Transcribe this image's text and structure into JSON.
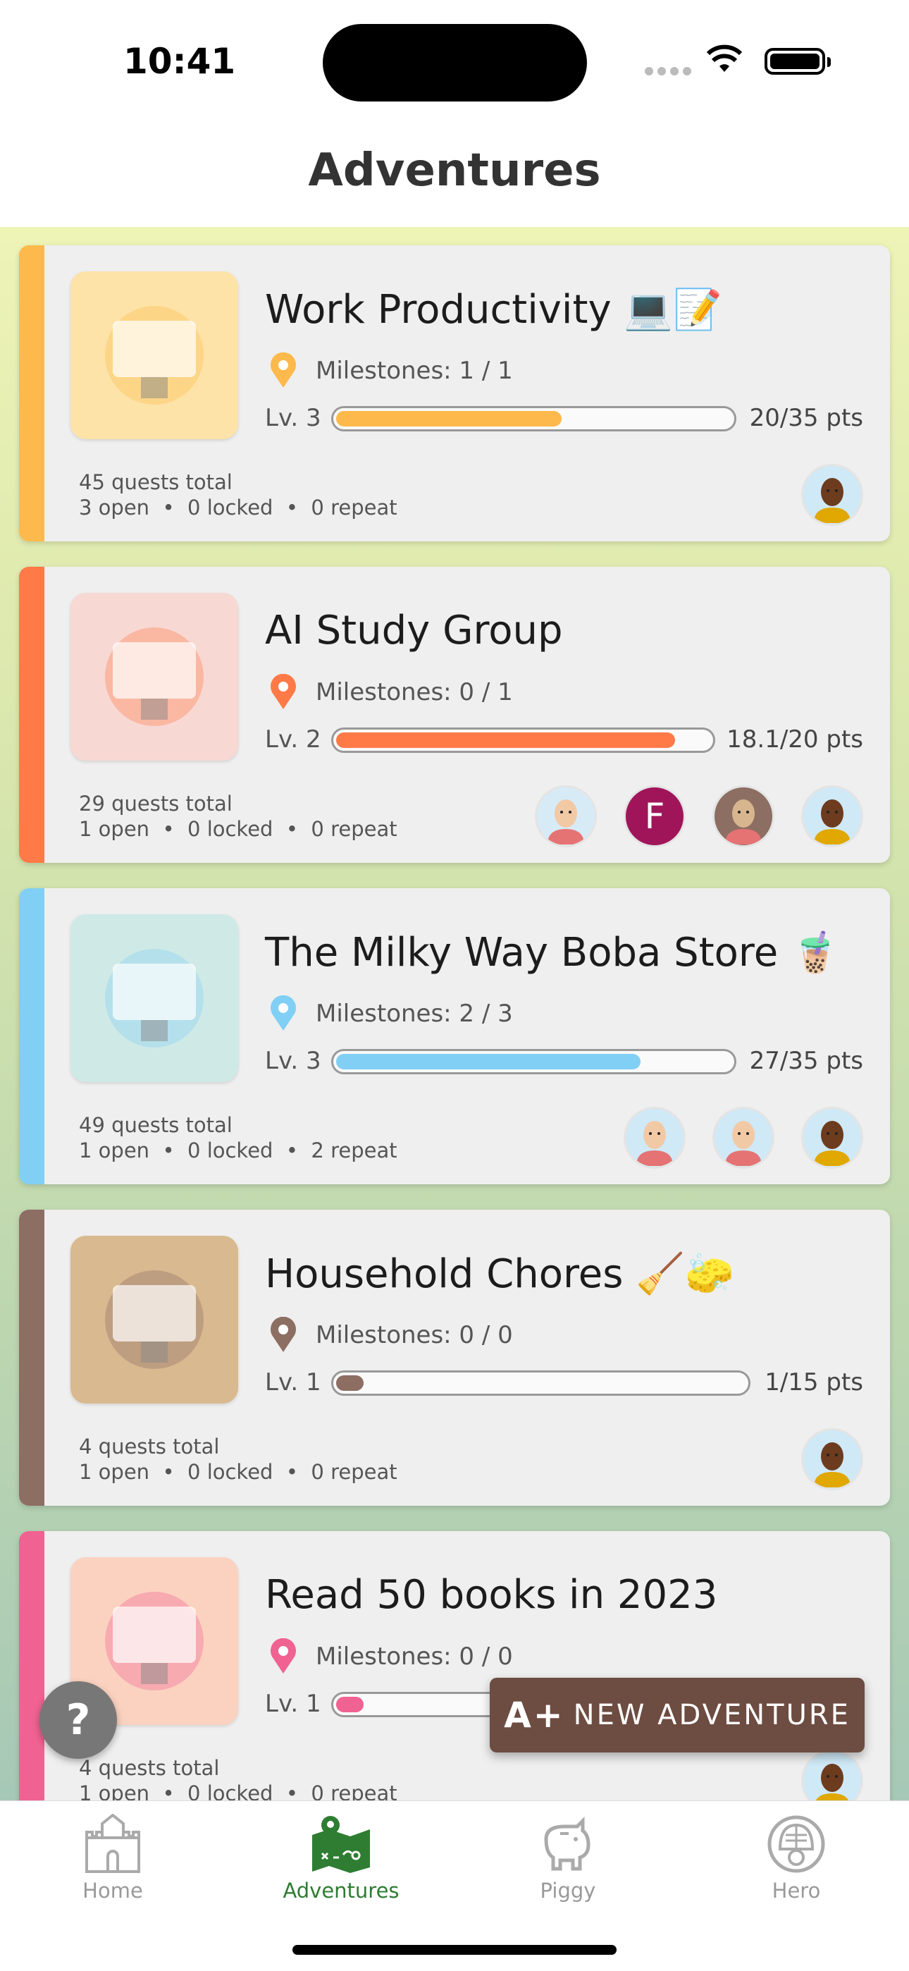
{
  "status_bar": {
    "time": "10:41"
  },
  "header": {
    "title": "Adventures"
  },
  "adventures": [
    {
      "title": "Work Productivity 💻📝",
      "color": "#fdb94c",
      "thumb_bg": "#fde3a7",
      "milestones": "Milestones: 1 / 1",
      "level": "Lv. 3",
      "points": "20/35 pts",
      "progress": 0.57,
      "quests_total": "45 quests total",
      "counts": "3 open  •  0 locked  •  0 repeat",
      "members": [
        "hero-avatar"
      ]
    },
    {
      "title": "AI Study Group",
      "color": "#ff7a47",
      "thumb_bg": "#f8d8d3",
      "milestones": "Milestones: 0 / 1",
      "level": "Lv. 2",
      "points": "18.1/20 pts",
      "progress": 0.905,
      "quests_total": "29 quests total",
      "counts": "1 open  •  0 locked  •  0 repeat",
      "members": [
        "redhead-avatar",
        "F",
        "sloth-avatar",
        "hero-avatar"
      ]
    },
    {
      "title": "The Milky Way Boba Store 🧋",
      "color": "#81cff5",
      "thumb_bg": "#cfeae6",
      "milestones": "Milestones: 2 / 3",
      "level": "Lv. 3",
      "points": "27/35 pts",
      "progress": 0.77,
      "quests_total": "49 quests total",
      "counts": "1 open  •  0 locked  •  2 repeat",
      "members": [
        "cap-boy-avatar",
        "girl-avatar",
        "hero-avatar"
      ]
    },
    {
      "title": "Household Chores 🧹🧽",
      "color": "#8d6e63",
      "thumb_bg": "#d9b98f",
      "milestones": "Milestones: 0 / 0",
      "level": "Lv. 1",
      "points": "1/15 pts",
      "progress": 0.067,
      "quests_total": "4 quests total",
      "counts": "1 open  •  0 locked  •  0 repeat",
      "members": [
        "hero-avatar"
      ]
    },
    {
      "title": "Read 50 books in 2023",
      "color": "#f06292",
      "thumb_bg": "#fbd2c0",
      "milestones": "Milestones: 0 / 0",
      "level": "Lv. 1",
      "points": "",
      "progress": 0.07,
      "quests_total": "4 quests total",
      "counts": "1 open  •  0 locked  •  0 repeat",
      "members": [
        "hero-avatar"
      ]
    }
  ],
  "help_button": "?",
  "new_adventure": {
    "icon": "A+",
    "label": "NEW ADVENTURE"
  },
  "tabs": [
    {
      "label": "Home",
      "icon": "castle-icon"
    },
    {
      "label": "Adventures",
      "icon": "map-icon",
      "active": true
    },
    {
      "label": "Piggy",
      "icon": "piggy-bank-icon"
    },
    {
      "label": "Hero",
      "icon": "knight-helmet-icon"
    }
  ]
}
